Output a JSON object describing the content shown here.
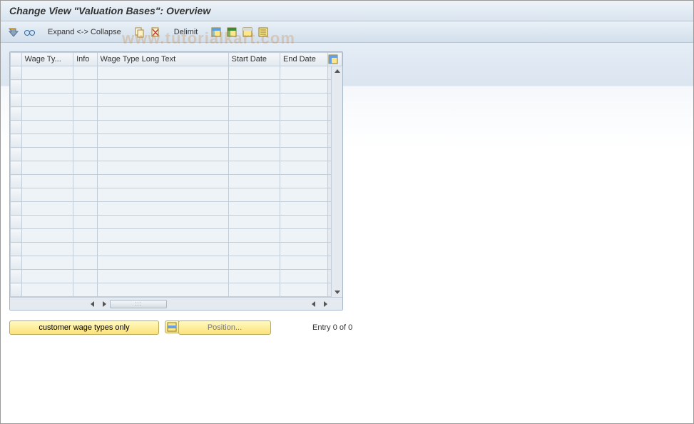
{
  "title": "Change View \"Valuation Bases\": Overview",
  "toolbar": {
    "expand_label": "Expand <-> Collapse",
    "delimit_label": "Delimit"
  },
  "grid": {
    "columns": {
      "wage_type": "Wage Ty...",
      "info": "Info",
      "long_text": "Wage Type Long Text",
      "start_date": "Start Date",
      "end_date": "End Date"
    },
    "row_count": 17
  },
  "footer": {
    "customer_button": "customer wage types only",
    "position_button": "Position...",
    "entry_text": "Entry 0 of 0"
  },
  "watermark": "www.tutorialkart.com"
}
